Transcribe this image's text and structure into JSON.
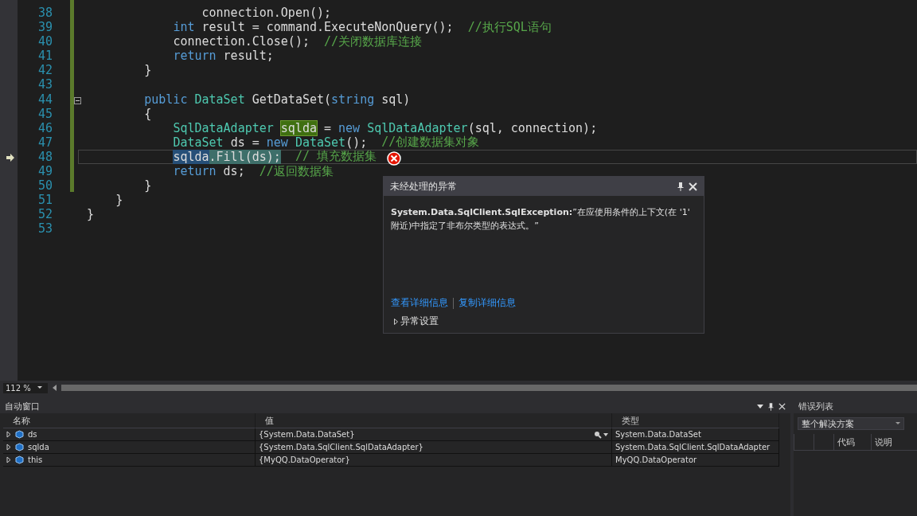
{
  "editor": {
    "lines": [
      {
        "number": "38",
        "tokens": [
          {
            "text": "                connection.Open();",
            "kind": "plain"
          }
        ]
      },
      {
        "number": "39",
        "tokens": [
          {
            "text": "            int",
            "kind": "keyword"
          },
          {
            "text": " result = command.ExecuteNonQuery();  ",
            "kind": "plain"
          },
          {
            "text": "//执行SQL语句",
            "kind": "comment"
          }
        ]
      },
      {
        "number": "40",
        "tokens": [
          {
            "text": "            connection.Close();  ",
            "kind": "plain"
          },
          {
            "text": "//关闭数据库连接",
            "kind": "comment"
          }
        ]
      },
      {
        "number": "41",
        "tokens": [
          {
            "text": "            return",
            "kind": "keyword"
          },
          {
            "text": " result;",
            "kind": "plain"
          }
        ]
      },
      {
        "number": "42",
        "tokens": [
          {
            "text": "        }",
            "kind": "plain"
          }
        ]
      },
      {
        "number": "43"
      },
      {
        "number": "44",
        "tokens": [
          {
            "text": "        public",
            "kind": "keyword"
          },
          {
            "text": " DataSet",
            "kind": "type"
          },
          {
            "text": " GetDataSet(",
            "kind": "plain"
          },
          {
            "text": "string",
            "kind": "keyword"
          },
          {
            "text": " sql)",
            "kind": "plain"
          }
        ]
      },
      {
        "number": "45",
        "tokens": [
          {
            "text": "        {",
            "kind": "plain"
          }
        ]
      },
      {
        "number": "46",
        "tokens": [
          {
            "text": "            SqlDataAdapter",
            "kind": "type"
          },
          {
            "text": "sqlda",
            "kind": "highlight"
          },
          {
            "text": " = ",
            "kind": "plain"
          },
          {
            "text": "new",
            "kind": "keyword"
          },
          {
            "text": " SqlDataAdapter",
            "kind": "type"
          },
          {
            "text": "(sql, connection);",
            "kind": "plain"
          }
        ]
      },
      {
        "number": "47",
        "tokens": [
          {
            "text": "            DataSet",
            "kind": "type"
          },
          {
            "text": " ds = ",
            "kind": "plain"
          },
          {
            "text": "new",
            "kind": "keyword"
          },
          {
            "text": " DataSet",
            "kind": "type"
          },
          {
            "text": "();  ",
            "kind": "plain"
          },
          {
            "text": "//创建数据集对象",
            "kind": "comment"
          }
        ]
      },
      {
        "number": "48",
        "current": true,
        "tokens": [
          {
            "text": "            sqlda",
            "kind": "selected"
          },
          {
            "text": ".Fill(ds);",
            "kind": "current"
          },
          {
            "text": "  // 填充数据集",
            "kind": "comment"
          }
        ]
      },
      {
        "number": "49",
        "tokens": [
          {
            "text": "            return",
            "kind": "keyword"
          },
          {
            "text": " ds;  ",
            "kind": "plain"
          },
          {
            "text": "//返回数据集",
            "kind": "comment"
          }
        ]
      },
      {
        "number": "50",
        "tokens": [
          {
            "text": "        }",
            "kind": "plain"
          }
        ]
      },
      {
        "number": "51",
        "tokens": [
          {
            "text": "    }",
            "kind": "plain"
          }
        ]
      },
      {
        "number": "52",
        "tokens": [
          {
            "text": "}",
            "kind": "plain"
          }
        ]
      },
      {
        "number": "53"
      }
    ],
    "zoom": "112 %"
  },
  "exception": {
    "title": "未经处理的异常",
    "type": "System.Data.SqlClient.SqlException:",
    "message": "”在应使用条件的上下文(在 '1' 附近)中指定了非布尔类型的表达式。”",
    "links": [
      "查看详细信息",
      "复制详细信息"
    ],
    "settings": "异常设置"
  },
  "autos": {
    "title": "自动窗口",
    "columns": [
      "名称",
      "值",
      "类型"
    ],
    "rows": [
      {
        "name": "ds",
        "value": "{System.Data.DataSet}",
        "type": "System.Data.DataSet",
        "search": true
      },
      {
        "name": "sqlda",
        "value": "{System.Data.SqlClient.SqlDataAdapter}",
        "type": "System.Data.SqlClient.SqlDataAdapter"
      },
      {
        "name": "this",
        "value": "{MyQQ.DataOperator}",
        "type": "MyQQ.DataOperator"
      }
    ]
  },
  "error_list": {
    "title": "错误列表",
    "scope": "整个解决方案",
    "columns": [
      "代码",
      "说明"
    ]
  }
}
